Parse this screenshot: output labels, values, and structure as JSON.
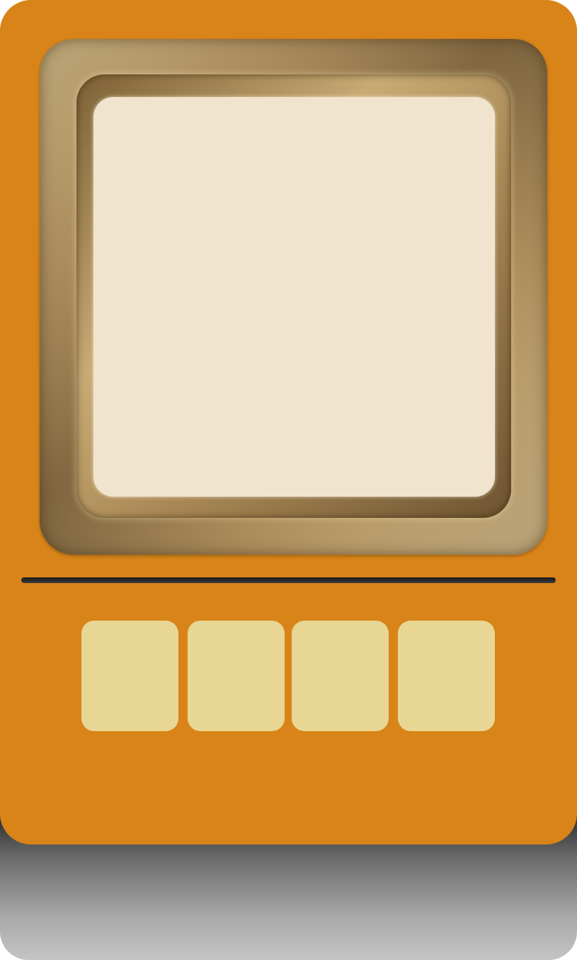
{
  "device": {
    "body_color": "#d88419",
    "screen_color": "#f1e4cf",
    "bezel_color": "#b39564",
    "key_color": "#e8d694"
  },
  "keys": [
    {
      "label": ""
    },
    {
      "label": ""
    },
    {
      "label": ""
    },
    {
      "label": ""
    }
  ],
  "screen": {
    "text": ""
  }
}
